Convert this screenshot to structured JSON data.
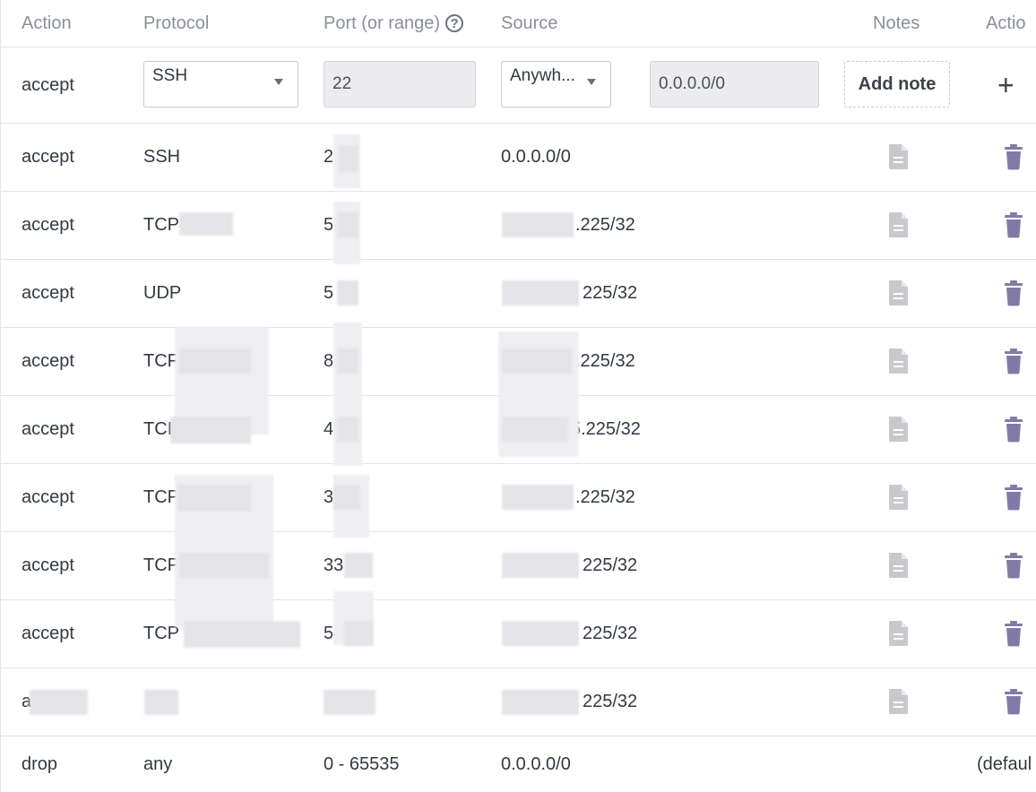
{
  "header": {
    "action": "Action",
    "protocol": "Protocol",
    "port": "Port (or range)",
    "help_glyph": "?",
    "source": "Source",
    "notes": "Notes",
    "actions": "Actio"
  },
  "new_rule": {
    "action": "accept",
    "protocol_selected": "SSH",
    "port_value": "22",
    "source_selected": "Anywh...",
    "source_ip": "0.0.0.0/0",
    "add_note_label": "Add note",
    "add_icon": "plus-icon"
  },
  "rules": [
    {
      "action": "accept",
      "protocol": "SSH",
      "port": "2",
      "source": "0.0.0.0/0"
    },
    {
      "action": "accept",
      "protocol": "TCP",
      "port": "5",
      "source": ".225/32"
    },
    {
      "action": "accept",
      "protocol": "UDP",
      "port": "5",
      "source": "225/32"
    },
    {
      "action": "accept",
      "protocol": "TCF",
      "port": "8",
      "source": ".225/32"
    },
    {
      "action": "accept",
      "protocol": "TCI",
      "port": "4",
      "source": "5.225/32"
    },
    {
      "action": "accept",
      "protocol": "TCP",
      "port": "3",
      "source": ".225/32"
    },
    {
      "action": "accept",
      "protocol": "TCP",
      "port": "33",
      "source": "225/32"
    },
    {
      "action": "accept",
      "protocol": "TCP",
      "port": "54",
      "source": "225/32"
    },
    {
      "action": "a",
      "protocol": "",
      "port": "",
      "source": "225/32"
    }
  ],
  "default_rule": {
    "action": "drop",
    "protocol": "any",
    "port": "0 - 65535",
    "source": "0.0.0.0/0",
    "actions": "(defaul"
  },
  "icons": {
    "note": "note-icon",
    "delete": "trash-icon"
  },
  "colors": {
    "trash": "#827aa6",
    "note": "#c9c9cd",
    "text": "#333842",
    "header": "#8a8f98"
  }
}
